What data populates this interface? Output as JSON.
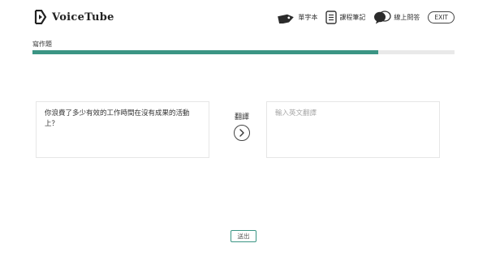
{
  "header": {
    "logo_text": "VoiceTube",
    "nav": {
      "vocab_label": "單字本",
      "notes_label": "課程筆記",
      "qa_label": "線上問答",
      "exit_label": "EXIT"
    }
  },
  "section": {
    "title": "寫作題",
    "progress_fraction": 0.82
  },
  "exercise": {
    "question": "你浪費了多少有效的工作時間在沒有成果的活動上？",
    "translate_label": "翻譯",
    "answer_placeholder": "輸入英文翻譯",
    "answer_value": ""
  },
  "footer": {
    "submit_label": "送出"
  },
  "colors": {
    "accent": "#3b9584",
    "track": "#e9e9e9"
  }
}
